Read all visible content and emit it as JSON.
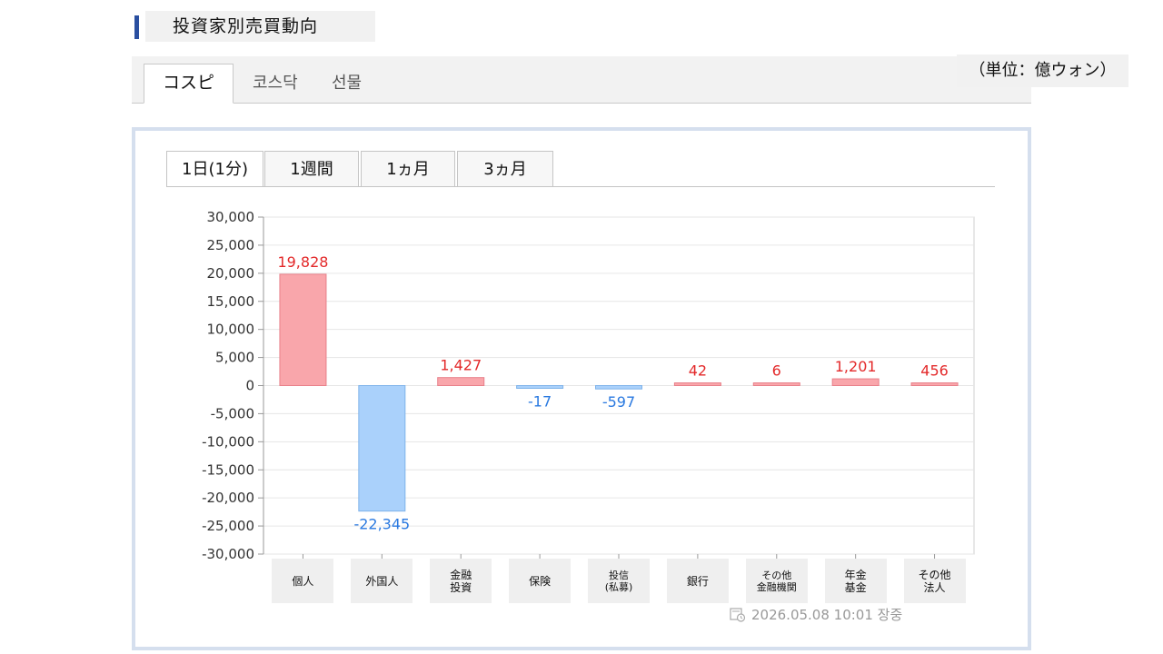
{
  "section_title": "投資家別売買動向",
  "unit_label": "（単位：億ウォン）",
  "market_tabs": [
    {
      "label": "コスピ",
      "active": true
    },
    {
      "label": "코스닥",
      "active": false
    },
    {
      "label": "선물",
      "active": false
    }
  ],
  "period_tabs": [
    {
      "label": "1日(1分)",
      "active": true
    },
    {
      "label": "1週間",
      "active": false
    },
    {
      "label": "1ヵ月",
      "active": false
    },
    {
      "label": "3ヵ月",
      "active": false
    }
  ],
  "timestamp": "2026.05.08 10:01 장중",
  "colors": {
    "positive_fill": "#f9a6ab",
    "positive_stroke": "#e8808a",
    "positive_label": "#e3292a",
    "negative_fill": "#aad1fb",
    "negative_stroke": "#7fb3ea",
    "negative_label": "#2a79e0"
  },
  "chart_data": {
    "type": "bar",
    "categories": [
      "個人",
      "外国人",
      "金融\n投資",
      "保険",
      "投信\n(私募)",
      "銀行",
      "その他\n金融機関",
      "年金\n基金",
      "その他\n法人"
    ],
    "values": [
      19828,
      -22345,
      1427,
      -17,
      -597,
      42,
      6,
      1201,
      456
    ],
    "value_labels": [
      "19,828",
      "-22,345",
      "1,427",
      "-17",
      "-597",
      "42",
      "6",
      "1,201",
      "456"
    ],
    "ylim": [
      -30000,
      30000
    ],
    "yticks": [
      30000,
      25000,
      20000,
      15000,
      10000,
      5000,
      0,
      -5000,
      -10000,
      -15000,
      -20000,
      -25000,
      -30000
    ],
    "ytick_labels": [
      "30,000",
      "25,000",
      "20,000",
      "15,000",
      "10,000",
      "5,000",
      "0",
      "-5,000",
      "-10,000",
      "-15,000",
      "-20,000",
      "-25,000",
      "-30,000"
    ],
    "grid": true
  }
}
